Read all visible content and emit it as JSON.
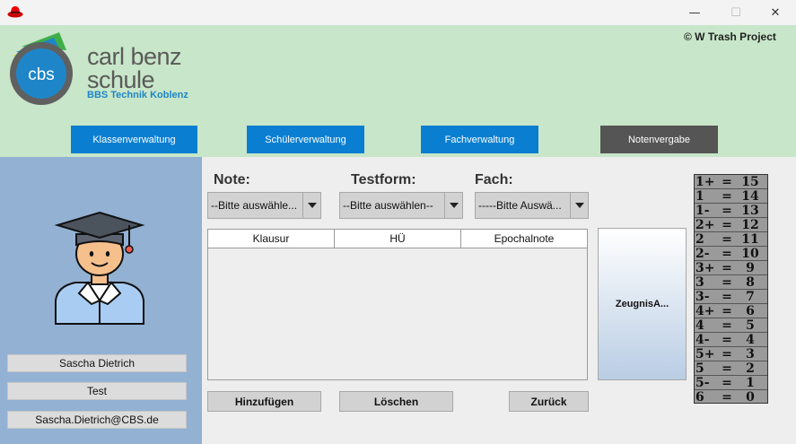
{
  "window": {
    "minimize": "—",
    "maximize": "☐",
    "close": "✕"
  },
  "header": {
    "logo_badge": "cbs",
    "logo_line1": "carl benz",
    "logo_line2": "schule",
    "logo_sub": "BBS Technik Koblenz",
    "copyright": "© W Trash Project"
  },
  "nav": [
    {
      "label": "Klassenverwaltung"
    },
    {
      "label": "Schülerverwaltung"
    },
    {
      "label": "Fachverwaltung"
    },
    {
      "label": "Notenvergabe"
    }
  ],
  "user": {
    "name": "Sascha Dietrich",
    "role": "Test",
    "email": "Sascha.Dietrich@CBS.de"
  },
  "form": {
    "note_label": "Note:",
    "testform_label": "Testform:",
    "fach_label": "Fach:",
    "note_value": "--Bitte auswähle...",
    "testform_value": "--Bitte auswählen--",
    "fach_value": "-----Bitte Auswä..."
  },
  "table": {
    "columns": [
      "Klausur",
      "HÜ",
      "Epochalnote"
    ]
  },
  "buttons": {
    "zeugnis": "ZeugnisA...",
    "add": "Hinzufügen",
    "delete": "Löschen",
    "back": "Zurück"
  },
  "grades": [
    {
      "note": "1+",
      "eq": "=",
      "points": "15"
    },
    {
      "note": "1",
      "eq": "=",
      "points": "14"
    },
    {
      "note": "1-",
      "eq": "=",
      "points": "13"
    },
    {
      "note": "2+",
      "eq": "=",
      "points": "12"
    },
    {
      "note": "2",
      "eq": "=",
      "points": "11"
    },
    {
      "note": "2-",
      "eq": "=",
      "points": "10"
    },
    {
      "note": "3+",
      "eq": "=",
      "points": "9"
    },
    {
      "note": "3",
      "eq": "=",
      "points": "8"
    },
    {
      "note": "3-",
      "eq": "=",
      "points": "7"
    },
    {
      "note": "4+",
      "eq": "=",
      "points": "6"
    },
    {
      "note": "4",
      "eq": "=",
      "points": "5"
    },
    {
      "note": "4-",
      "eq": "=",
      "points": "4"
    },
    {
      "note": "5+",
      "eq": "=",
      "points": "3"
    },
    {
      "note": "5",
      "eq": "=",
      "points": "2"
    },
    {
      "note": "5-",
      "eq": "=",
      "points": "1"
    },
    {
      "note": "6",
      "eq": "=",
      "points": "0"
    }
  ]
}
